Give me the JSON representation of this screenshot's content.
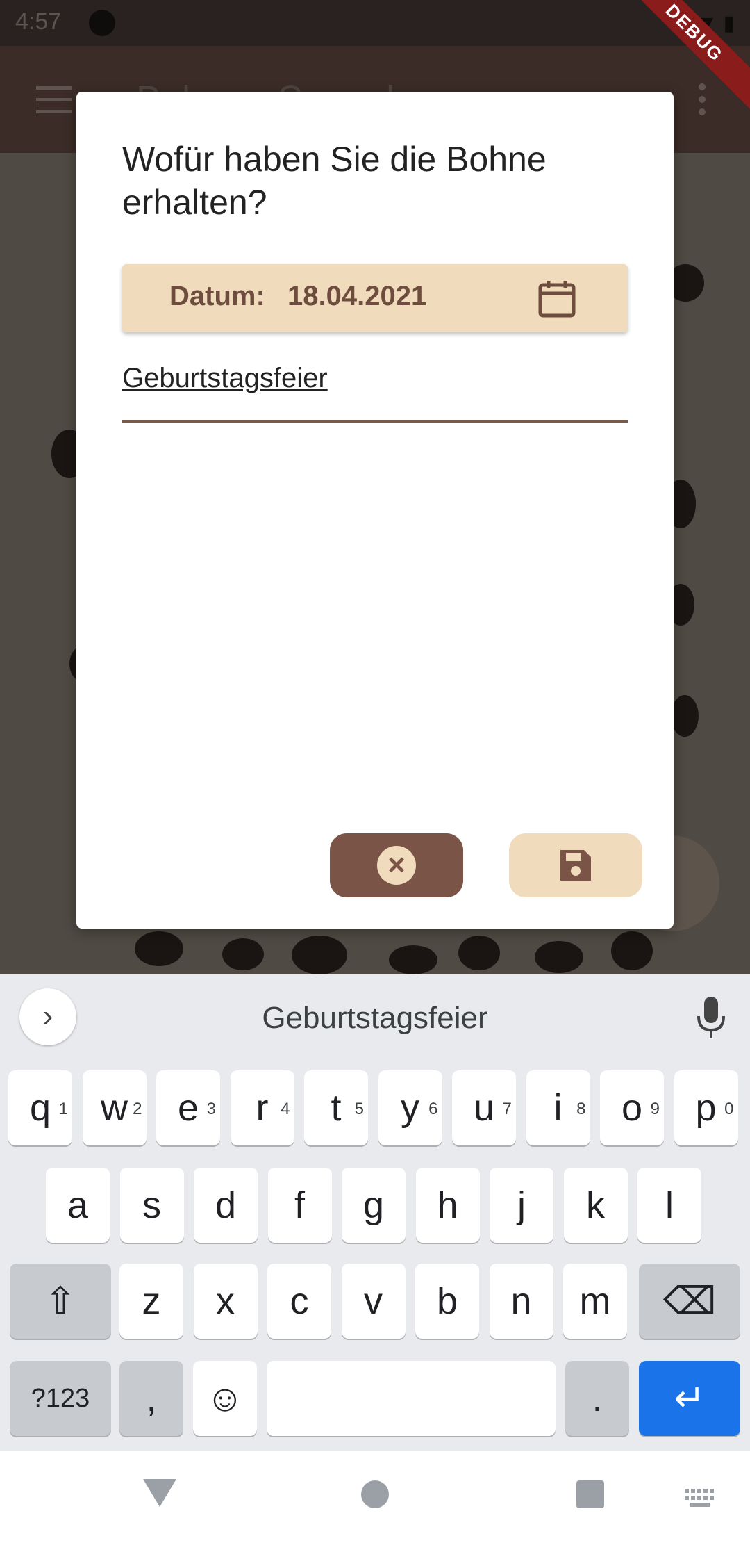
{
  "status_bar": {
    "time": "4:57"
  },
  "app_bar": {
    "title": "Bohnen-Sammlung"
  },
  "dialog": {
    "title": "Wofür haben Sie die Bohne erhalten?",
    "date_label": "Datum:",
    "date_value": "18.04.2021",
    "reason_value": "Geburtstagsfeier"
  },
  "debug_banner": "DEBUG",
  "keyboard": {
    "suggestion": "Geburtstagsfeier",
    "row1": [
      {
        "k": "q",
        "s": "1"
      },
      {
        "k": "w",
        "s": "2"
      },
      {
        "k": "e",
        "s": "3"
      },
      {
        "k": "r",
        "s": "4"
      },
      {
        "k": "t",
        "s": "5"
      },
      {
        "k": "y",
        "s": "6"
      },
      {
        "k": "u",
        "s": "7"
      },
      {
        "k": "i",
        "s": "8"
      },
      {
        "k": "o",
        "s": "9"
      },
      {
        "k": "p",
        "s": "0"
      }
    ],
    "row2": [
      "a",
      "s",
      "d",
      "f",
      "g",
      "h",
      "j",
      "k",
      "l"
    ],
    "row3": [
      "z",
      "x",
      "c",
      "v",
      "b",
      "n",
      "m"
    ],
    "symbols_label": "?123",
    "comma": ",",
    "period": "."
  },
  "colors": {
    "brown": "#7a5446",
    "beige": "#f0dcbd",
    "keyboard_enter": "#1a73e8"
  }
}
